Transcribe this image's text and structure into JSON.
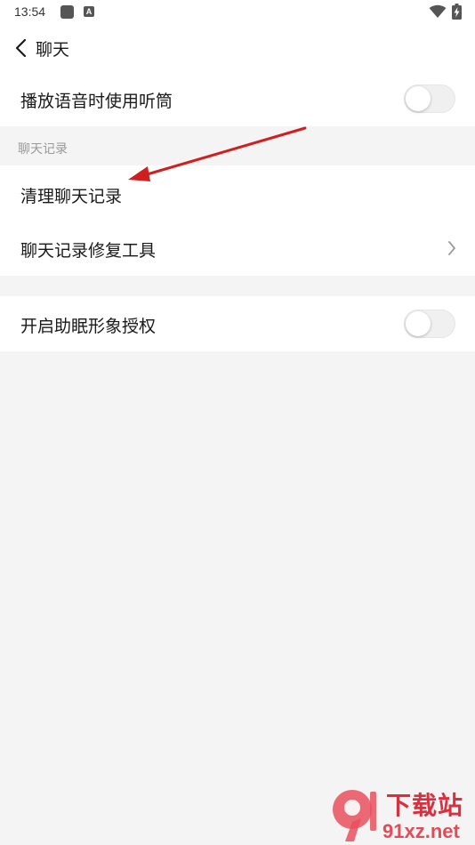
{
  "status_bar": {
    "time": "13:54",
    "notification_icons": [
      "square-app-icon",
      "a-icon"
    ],
    "system_icons": [
      "wifi-icon",
      "battery-charging-icon"
    ]
  },
  "header": {
    "back_icon": "chevron-left-icon",
    "title": "聊天"
  },
  "settings": {
    "earpiece_playback": {
      "label": "播放语音时使用听筒",
      "toggle_on": false
    },
    "chat_history_section": {
      "title": "聊天记录",
      "items": [
        {
          "label": "清理聊天记录"
        },
        {
          "label": "聊天记录修复工具",
          "icon": "chevron-right-icon"
        }
      ]
    },
    "sleep_aid_authorization": {
      "label": "开启助眠形象授权",
      "toggle_on": false
    }
  },
  "annotation": {
    "color": "#d01f1f",
    "target": "清理聊天记录"
  },
  "watermark": {
    "logo_text": "9",
    "title": "下载站",
    "url": "91xz.net"
  }
}
